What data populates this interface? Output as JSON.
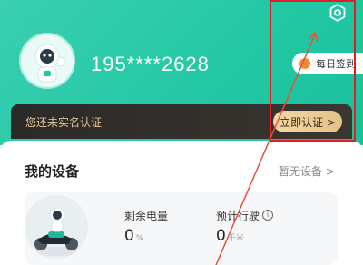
{
  "profile": {
    "phone": "195****2628"
  },
  "header": {
    "checkin_label": "每日签到"
  },
  "verify": {
    "text": "您还未实名认证",
    "button_label": "立即认证 >"
  },
  "devices": {
    "title": "我的设备",
    "no_device": "暂无设备 >",
    "battery_label": "剩余电量",
    "battery_value": "0",
    "battery_unit": "%",
    "range_label": "预计行驶",
    "range_value": "0",
    "range_unit": "千米",
    "info_symbol": "i"
  },
  "icons": [
    "settings-icon",
    "coin-icon",
    "info-icon",
    "scooter-illustration",
    "avatar-mascot"
  ],
  "colors": {
    "header": "#22c7a4",
    "gold": "#e6c189",
    "highlight": "#e02020"
  }
}
